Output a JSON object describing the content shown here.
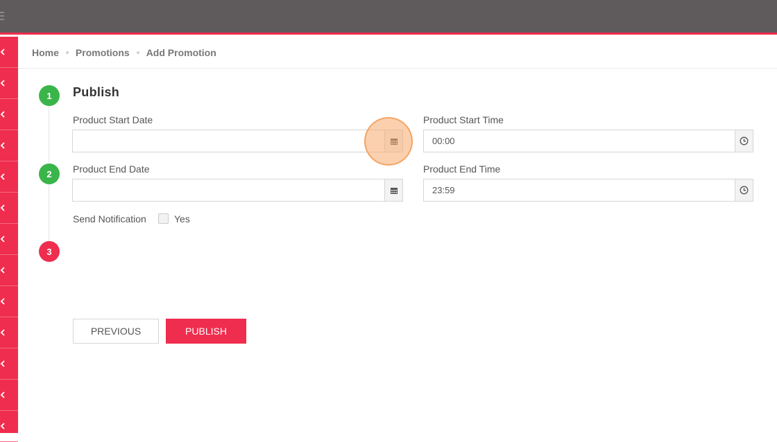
{
  "header": {
    "menu_icon": "hamburger-icon"
  },
  "sidebar": {
    "items": [
      {
        "icon": "chevron-left-icon"
      },
      {
        "icon": "chevron-left-icon"
      },
      {
        "icon": "chevron-left-icon"
      },
      {
        "icon": "chevron-left-icon"
      },
      {
        "icon": "chevron-left-icon"
      },
      {
        "icon": "chevron-left-icon"
      },
      {
        "icon": "chevron-left-icon"
      },
      {
        "icon": "chevron-left-icon"
      },
      {
        "icon": "chevron-left-icon"
      },
      {
        "icon": "chevron-left-icon"
      },
      {
        "icon": "chevron-left-icon"
      },
      {
        "icon": "chevron-left-icon"
      },
      {
        "icon": "chevron-left-icon"
      }
    ]
  },
  "breadcrumb": {
    "home": "Home",
    "promotions": "Promotions",
    "current": "Add Promotion"
  },
  "steps": [
    "1",
    "2",
    "3"
  ],
  "section": {
    "title": "Publish"
  },
  "form": {
    "start_date": {
      "label": "Product Start Date",
      "value": "",
      "icon": "calendar-icon"
    },
    "start_time": {
      "label": "Product Start Time",
      "value": "00:00",
      "icon": "clock-icon"
    },
    "end_date": {
      "label": "Product End Date",
      "value": "",
      "icon": "calendar-icon"
    },
    "end_time": {
      "label": "Product End Time",
      "value": "23:59",
      "icon": "clock-icon"
    },
    "notification": {
      "label": "Send Notification",
      "option": "Yes",
      "checked": false
    }
  },
  "buttons": {
    "previous": "PREVIOUS",
    "publish": "PUBLISH"
  },
  "colors": {
    "accent": "#ef2d4e",
    "topbar": "#5f5a5b",
    "step_done": "#3ab54a",
    "highlight": "#f7aa6e"
  }
}
